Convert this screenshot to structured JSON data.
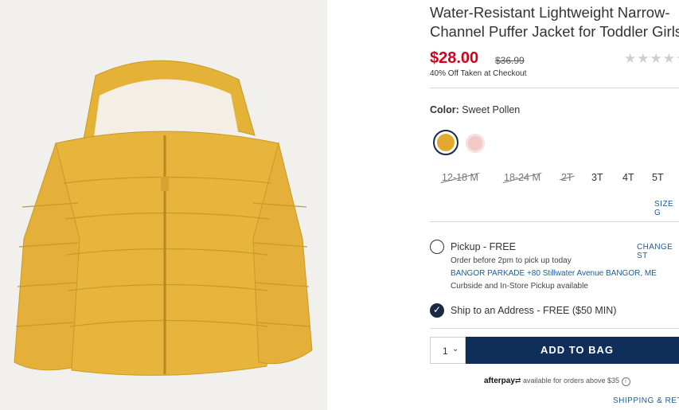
{
  "product": {
    "title_line1": "Water-Resistant Lightweight Narrow-",
    "title_line2": "Channel Puffer Jacket for Toddler Girls",
    "price": "$28.00",
    "original_price": "$36.99",
    "promo": "40% Off Taken at Checkout",
    "rating_stars": "★★★★★",
    "image_icon": "yellow-puffer-jacket-photo"
  },
  "color": {
    "label": "Color:",
    "value": "Sweet Pollen",
    "swatches": [
      {
        "name": "Sweet Pollen",
        "hex": "#e2a92c",
        "selected": true
      },
      {
        "name": "Pink",
        "hex": "#f1c9c6",
        "selected": false
      }
    ]
  },
  "sizes": [
    {
      "label": "12-18 M",
      "available": false
    },
    {
      "label": "18-24 M",
      "available": false
    },
    {
      "label": "2T",
      "available": false
    },
    {
      "label": "3T",
      "available": true
    },
    {
      "label": "4T",
      "available": true
    },
    {
      "label": "5T",
      "available": true
    }
  ],
  "size_guide": "SIZE G",
  "pickup": {
    "label": "Pickup - FREE",
    "change": "CHANGE ST",
    "order_before": "Order before 2pm to pick up today",
    "store": "BANGOR PARKADE +80 Stillwater Avenue  BANGOR, ME",
    "note": "Curbside and In-Store Pickup available"
  },
  "ship": {
    "label": "Ship to an Address - FREE ($50 MIN)"
  },
  "cart": {
    "quantity": "1",
    "add_label": "ADD TO BAG"
  },
  "afterpay": {
    "brand": "afterpay",
    "text": "available for orders above $35"
  },
  "shipping_link": "SHIPPING & RETU",
  "colors": {
    "sale_red": "#d0021b",
    "navy": "#0f2e5a",
    "link_blue": "#1d5c9c"
  }
}
